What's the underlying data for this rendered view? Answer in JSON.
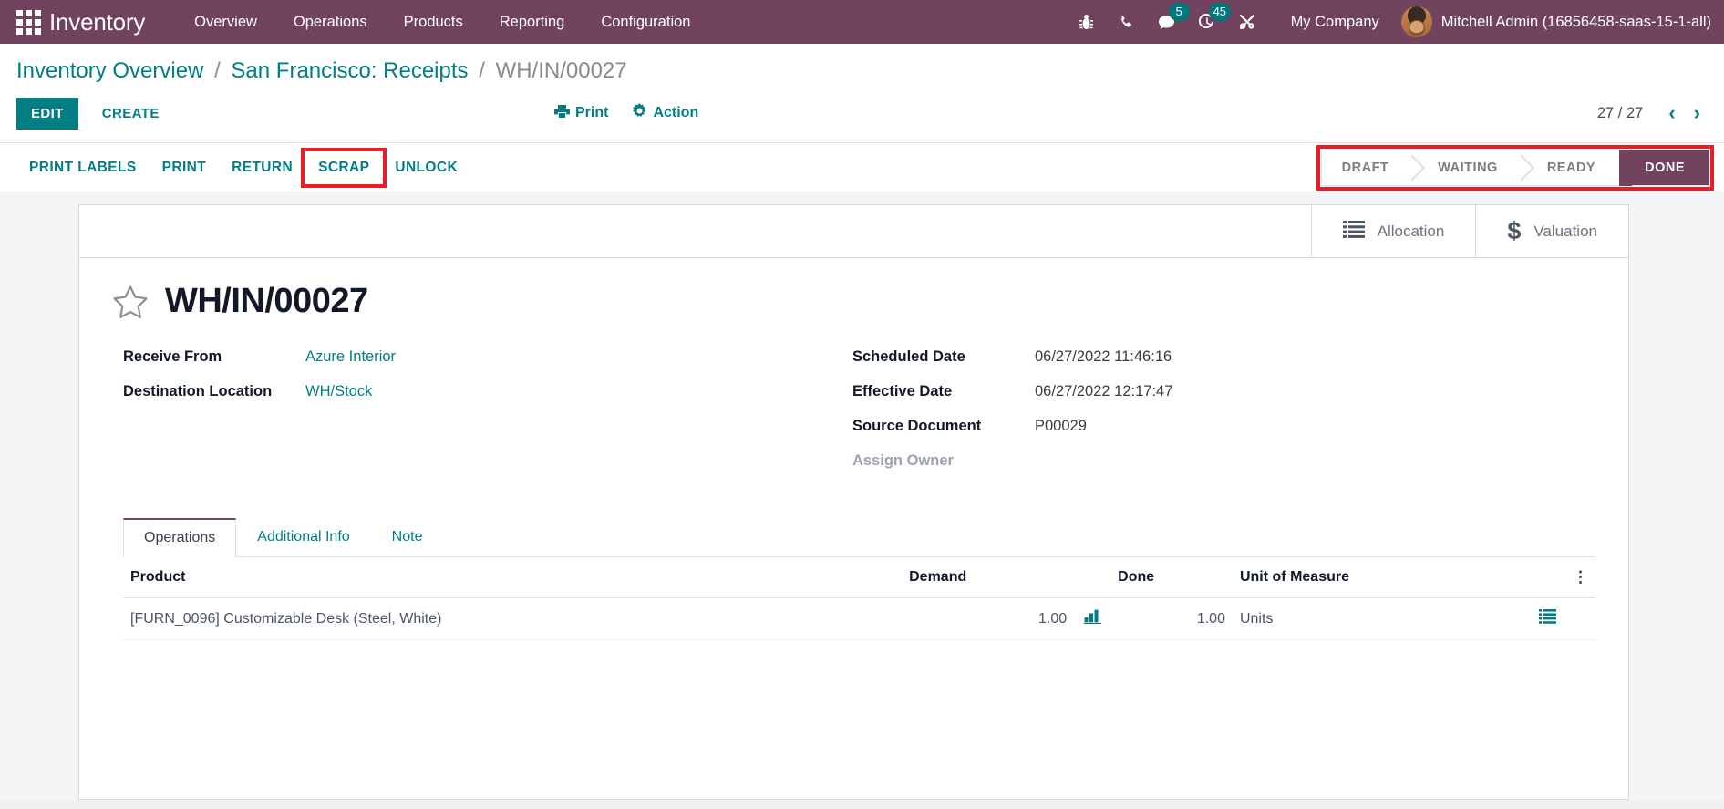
{
  "navbar": {
    "apps_icon": "apps-grid-icon",
    "brand": "Inventory",
    "menu": [
      {
        "label": "Overview"
      },
      {
        "label": "Operations"
      },
      {
        "label": "Products"
      },
      {
        "label": "Reporting"
      },
      {
        "label": "Configuration"
      }
    ],
    "sys_icons": [
      {
        "name": "bug-icon",
        "badge": null
      },
      {
        "name": "phone-icon",
        "badge": null
      },
      {
        "name": "messages-icon",
        "badge": "5"
      },
      {
        "name": "activities-clock-icon",
        "badge": "45"
      },
      {
        "name": "tools-icon",
        "badge": null
      }
    ],
    "company": "My Company",
    "user": "Mitchell Admin (16856458-saas-15-1-all)",
    "bg_color": "#71435f",
    "badge_color": "#00787a"
  },
  "breadcrumb": {
    "root": "Inventory Overview",
    "sep": "/",
    "parent": "San Francisco: Receipts",
    "current": "WH/IN/00027"
  },
  "controlpanel": {
    "edit_label": "EDIT",
    "create_label": "CREATE",
    "print_label": "Print",
    "action_label": "Action",
    "pager_count": "27 / 27",
    "prev_icon": "chevron-left-icon",
    "next_icon": "chevron-right-icon",
    "accent_color": "#017e84"
  },
  "actionbar": {
    "buttons": [
      {
        "label": "PRINT LABELS",
        "highlighted": false
      },
      {
        "label": "PRINT",
        "highlighted": false
      },
      {
        "label": "RETURN",
        "highlighted": false
      },
      {
        "label": "SCRAP",
        "highlighted": true
      },
      {
        "label": "UNLOCK",
        "highlighted": false
      }
    ],
    "highlight_color": "#ed1c24"
  },
  "statusbar": {
    "stages": [
      {
        "label": "DRAFT",
        "active": false
      },
      {
        "label": "WAITING",
        "active": false
      },
      {
        "label": "READY",
        "active": false
      },
      {
        "label": "DONE",
        "active": true
      }
    ],
    "active_color": "#71435f",
    "highlighted": true
  },
  "smart_buttons": [
    {
      "label": "Allocation",
      "icon": "list-icon"
    },
    {
      "label": "Valuation",
      "icon": "dollar-icon"
    }
  ],
  "record": {
    "star_icon": "star-outline-icon",
    "title": "WH/IN/00027",
    "fields_left": [
      {
        "label": "Receive From",
        "value": "Azure Interior",
        "link": true
      },
      {
        "label": "Destination Location",
        "value": "WH/Stock",
        "link": true
      }
    ],
    "fields_right": [
      {
        "label": "Scheduled Date",
        "value": "06/27/2022 11:46:16",
        "link": false,
        "muted_label": false
      },
      {
        "label": "Effective Date",
        "value": "06/27/2022 12:17:47",
        "link": false,
        "muted_label": false
      },
      {
        "label": "Source Document",
        "value": "P00029",
        "link": false,
        "muted_label": false
      },
      {
        "label": "Assign Owner",
        "value": "",
        "link": false,
        "muted_label": true
      }
    ]
  },
  "notebook": {
    "tabs": [
      {
        "label": "Operations",
        "active": true
      },
      {
        "label": "Additional Info",
        "active": false
      },
      {
        "label": "Note",
        "active": false
      }
    ],
    "columns": [
      "Product",
      "Demand",
      "Done",
      "Unit of Measure"
    ],
    "options_icon": "column-options-icon",
    "rows": [
      {
        "product": "[FURN_0096] Customizable Desk (Steel, White)",
        "demand": "1.00",
        "demand_icon": "forecast-chart-icon",
        "done": "1.00",
        "uom": "Units",
        "row_icon": "detailed-operations-icon"
      }
    ]
  }
}
